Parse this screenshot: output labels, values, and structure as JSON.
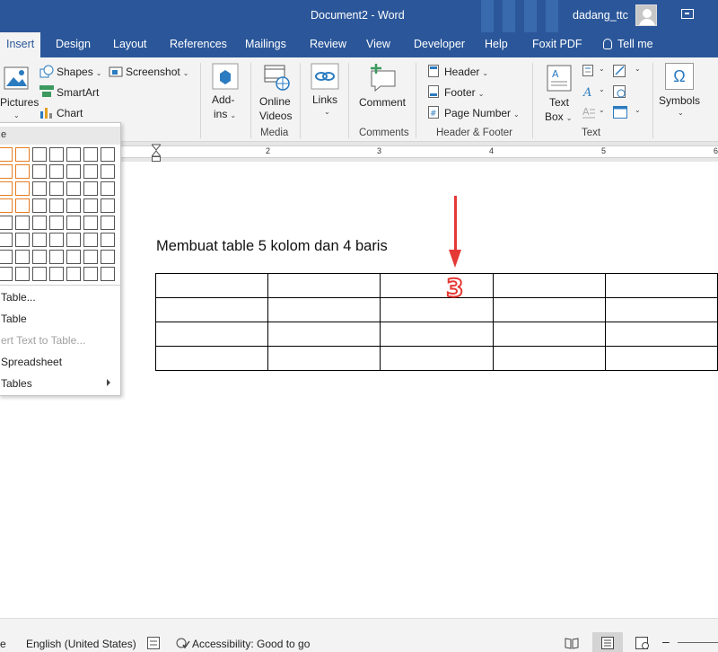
{
  "window": {
    "title": "Document2 - Word",
    "user": "dadang_ttc"
  },
  "tabs": [
    {
      "label": "Insert"
    },
    {
      "label": "Design"
    },
    {
      "label": "Layout"
    },
    {
      "label": "References"
    },
    {
      "label": "Mailings"
    },
    {
      "label": "Review"
    },
    {
      "label": "View"
    },
    {
      "label": "Developer"
    },
    {
      "label": "Help"
    },
    {
      "label": "Foxit PDF"
    },
    {
      "label": "Tell me"
    }
  ],
  "ribbon": {
    "illustrations": {
      "pictures": "Pictures",
      "shapes": "Shapes",
      "smartart": "SmartArt",
      "chart": "Chart",
      "screenshot": "Screenshot"
    },
    "addins": {
      "line1": "Add-",
      "line2": "ins"
    },
    "media": {
      "line1": "Online",
      "line2": "Videos",
      "group": "Media"
    },
    "links": {
      "label": "Links"
    },
    "comments": {
      "label": "Comment",
      "group": "Comments"
    },
    "header_footer": {
      "header": "Header",
      "footer": "Footer",
      "page_number": "Page Number",
      "group": "Header & Footer"
    },
    "text": {
      "line1": "Text",
      "line2": "Box",
      "group": "Text"
    },
    "symbols": {
      "label": "Symbols",
      "omega": "Ω"
    }
  },
  "ruler": {
    "numbers": [
      "2",
      "3",
      "4",
      "5",
      "6"
    ]
  },
  "document": {
    "heading": "Membuat table 5 kolom dan 4 baris",
    "table": {
      "columns": 5,
      "rows": 4
    },
    "annotation": "3",
    "annotation_color": "#e53935"
  },
  "table_menu": {
    "header": "e",
    "grid": {
      "columns": 7,
      "rows": 8,
      "highlighted_columns": 2,
      "highlighted_rows": 4
    },
    "items": [
      {
        "label": "Table...",
        "enabled": true
      },
      {
        "label": "Table",
        "enabled": true
      },
      {
        "label": "ert Text to Table...",
        "enabled": false
      },
      {
        "label": "Spreadsheet",
        "enabled": true
      },
      {
        "label": "Tables",
        "enabled": true
      }
    ]
  },
  "statusbar": {
    "left_glyph": "e",
    "language": "English (United States)",
    "accessibility": "Accessibility: Good to go"
  },
  "colors": {
    "word_blue": "#2b579a",
    "highlight_orange": "#e67e22",
    "ribbon_bg": "#f3f3f3"
  }
}
